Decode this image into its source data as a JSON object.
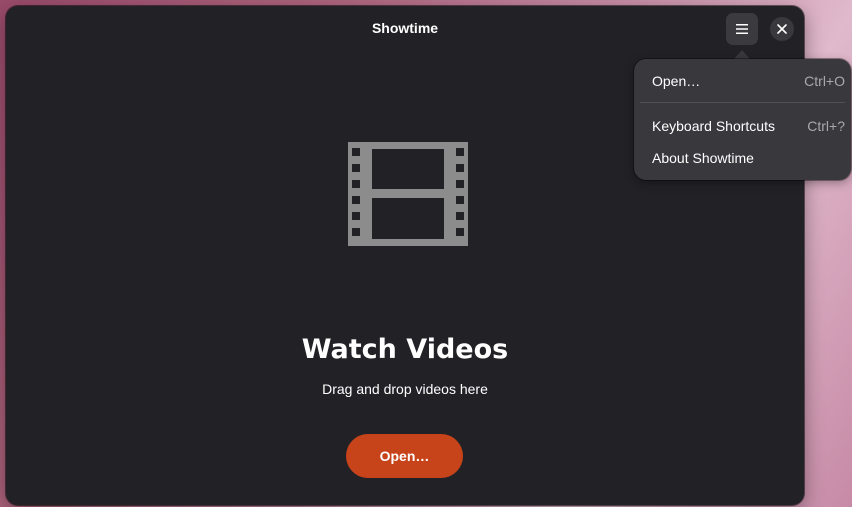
{
  "window": {
    "title": "Showtime"
  },
  "headerbar": {
    "menu_icon": "hamburger-menu-icon",
    "close_icon": "close-icon"
  },
  "status_page": {
    "icon": "film-strip-icon",
    "title": "Watch Videos",
    "description": "Drag and drop videos here",
    "open_button_label": "Open…"
  },
  "menu": {
    "items": [
      {
        "label": "Open…",
        "shortcut": "Ctrl+O"
      },
      {
        "label": "Keyboard Shortcuts",
        "shortcut": "Ctrl+?"
      },
      {
        "label": "About Showtime",
        "shortcut": ""
      }
    ]
  },
  "colors": {
    "window_bg": "#222226",
    "accent": "#c7431a",
    "popover_bg": "#38383d",
    "icon_gray": "#8c8c8c"
  }
}
